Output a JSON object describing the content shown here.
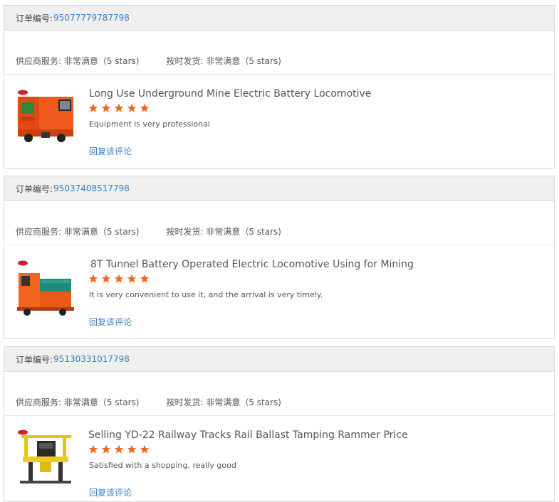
{
  "reviews": [
    {
      "order_label": "订单编号:",
      "order_number": "95077779787798",
      "supplier_service": "供应商服务: 非常满意（5 stars)",
      "on_time_delivery": "按时发货: 非常满意（5 stars)",
      "product_title": "Long Use Underground Mine Electric Battery Locomotive",
      "rating": 5,
      "comment": "Equipment is very professional",
      "reply_label": "回复该评论"
    },
    {
      "order_label": "订单编号:",
      "order_number": "95037408517798",
      "supplier_service": "供应商服务: 非常满意（5 stars)",
      "on_time_delivery": "按时发货: 非常满意（5 stars)",
      "product_title": "8T Tunnel Battery Operated Electric Locomotive Using for Mining",
      "rating": 5,
      "comment": "It is very convenient to use it, and the arrival is very timely.",
      "reply_label": "回复该评论"
    },
    {
      "order_label": "订单编号:",
      "order_number": "95130331017798",
      "supplier_service": "供应商服务: 非常满意（5 stars)",
      "on_time_delivery": "按时发货: 非常满意（5 stars)",
      "product_title": "Selling YD-22 Railway Tracks Rail Ballast Tamping Rammer Price",
      "rating": 5,
      "comment": "Satisfied with a shopping, really good",
      "reply_label": "回复该评论"
    }
  ],
  "colors": {
    "star": "#f26522",
    "link": "#3a7fc4",
    "header_bg": "#efefef"
  }
}
